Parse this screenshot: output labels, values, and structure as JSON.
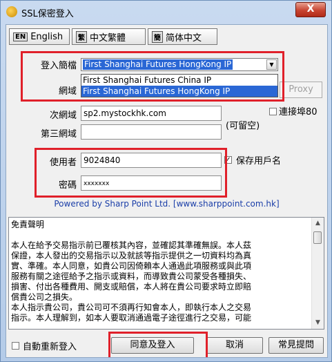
{
  "window": {
    "title": "SSL保密登入",
    "close_label": "X"
  },
  "lang": {
    "english": "English",
    "english_tag": "EN",
    "trad": "中文繁體",
    "trad_tag": "繁",
    "simp": "简体中文",
    "simp_tag": "簡"
  },
  "form": {
    "login_label": "登入簡檔",
    "login_value": "First Shanghai Futures  HongKong IP",
    "dropdown_options": [
      "First Shanghai Futures  China IP",
      "First Shanghai Futures  HongKong IP"
    ],
    "domain_label": "網域",
    "proxy_label": "Proxy",
    "sub_domain_label": "次網域",
    "sub_domain_value": "sp2.mystockhk.com",
    "connect_port_label": "連接埠80",
    "third_domain_label": "第三網域",
    "optional_label": "(可留空)",
    "user_label": "使用者",
    "user_value": "9024840",
    "password_label": "密碼",
    "password_value": "xxxxxxx",
    "save_user_label": "保存用戶名"
  },
  "powered_by": "Powered by Sharp Point Ltd. [www.sharppoint.com.hk]",
  "disclaimer": {
    "title": "免責聲明",
    "body": "本人在給予交易指示前已覆核其內容，並確認其準確無誤。本人茲\n保證，本人發出的交易指示以及就該等指示提供之一切資料均為真\n實、準確。本人同意，如貴公司因倚賴本人通過此項服務或與此項\n服務有關之途徑給予之指示或資料，而導致貴公司蒙受各種損失、\n損害、付出各種費用、開支或賠償，本人將在貴公司要求時立即賠\n償貴公司之損失。\n本人指示貴公司，貴公司可不須再行知會本人，即執行本人之交易\n指示。本人理解到，如本人要取消通過電子途徑進行之交易，可能"
  },
  "footer": {
    "auto_relogin_label": "自動重新登入",
    "agree_login": "同意及登入",
    "cancel": "取消",
    "faq": "常見提問"
  }
}
